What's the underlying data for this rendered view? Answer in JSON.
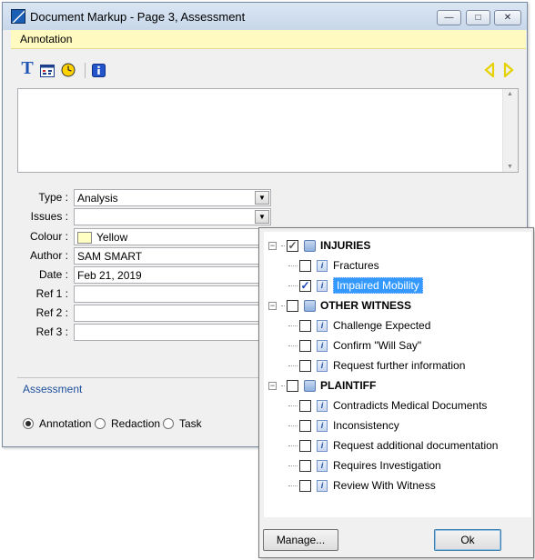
{
  "window": {
    "title": "Document Markup - Page 3, Assessment",
    "annotation_bar_label": "Annotation",
    "controls": {
      "minimize": "—",
      "maximize": "□",
      "close": "✕"
    }
  },
  "toolbar": {
    "text_glyph": "T",
    "icons": [
      "text-icon",
      "calendar-icon",
      "clock-icon",
      "info-icon",
      "previous-arrow-icon",
      "next-arrow-icon"
    ]
  },
  "form": {
    "type_label": "Type :",
    "type_value": "Analysis",
    "issues_label": "Issues :",
    "issues_value": "",
    "colour_label": "Colour :",
    "colour_value": "Yellow",
    "author_label": "Author :",
    "author_value": "SAM SMART",
    "date_label": "Date :",
    "date_value": "Feb 21, 2019",
    "ref1_label": "Ref 1 :",
    "ref2_label": "Ref 2 :",
    "ref3_label": "Ref 3 :"
  },
  "assessment_tab": "Assessment",
  "radios": {
    "annotation": "Annotation",
    "redaction": "Redaction",
    "task": "Task",
    "selected": "Annotation"
  },
  "issues_popup": {
    "groups": [
      {
        "label": "INJURIES",
        "checked": true,
        "items": [
          {
            "label": "Fractures",
            "checked": false
          },
          {
            "label": "Impaired Mobility",
            "checked": true,
            "selected": true
          }
        ]
      },
      {
        "label": "OTHER WITNESS",
        "checked": false,
        "items": [
          {
            "label": "Challenge Expected",
            "checked": false
          },
          {
            "label": "Confirm \"Will Say\"",
            "checked": false
          },
          {
            "label": "Request further information",
            "checked": false
          }
        ]
      },
      {
        "label": "PLAINTIFF",
        "checked": false,
        "items": [
          {
            "label": "Contradicts Medical Documents",
            "checked": false
          },
          {
            "label": "Inconsistency",
            "checked": false
          },
          {
            "label": "Request additional documentation",
            "checked": false
          },
          {
            "label": "Requires Investigation",
            "checked": false
          },
          {
            "label": "Review With Witness",
            "checked": false
          }
        ]
      }
    ],
    "manage_button": "Manage...",
    "ok_button": "Ok"
  },
  "colors": {
    "annotation_bar": "#fffabf",
    "selection": "#3399ff",
    "swatch_yellow": "#ffffc4",
    "arrow_yellow": "#e6d200"
  }
}
